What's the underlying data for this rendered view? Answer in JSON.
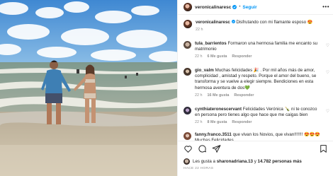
{
  "post": {
    "username": "veronicalinaresc",
    "verified_icon": "verified-badge-icon",
    "dot": "•",
    "follow_label": "Seguir",
    "more_icon": "•••",
    "caption": "Disfrutando con mi flamante esposo 😍",
    "caption_time": "22 h"
  },
  "comments": [
    {
      "username": "tula_barrientos",
      "text": "Formaron una hermosa familia me encanto su matrimonio",
      "time": "22 h",
      "likes": "6 Me gusta",
      "reply": "Responder"
    },
    {
      "username": "gio_valm",
      "text": "Muchas felicidades 🎉 . Por mil años más de amor, complicidad , amistad y respeto. Porque el amor del bueno, se transforma y se vuelve a elegir siempre. Bendiciones en esta hermosa aventura de dos💚",
      "time": "22 h",
      "likes": "16 Me gusta",
      "reply": "Responder"
    },
    {
      "username": "cynthiateronescervant",
      "text": "Felicidades Verónica 🍾 ni te conozco en persona pero tienes algo que hace que me caigas bien",
      "time": "22 h",
      "likes": "8 Me gusta",
      "reply": "Responder"
    },
    {
      "username": "fanny.franco.3511",
      "text": "que vivan los Novios, que vivan!!!!!!! 😍😍😍 Muchas Felicidades",
      "time": "",
      "likes": "",
      "reply": ""
    }
  ],
  "actions": {
    "liked_by_prefix": "Les gusta a",
    "liked_by_user": "sharonadriana.13",
    "liked_by_connector": "y",
    "liked_by_count": "14.782 personas más",
    "date": "HACE 22 HORAS"
  },
  "colors": {
    "accent": "#0095f6",
    "heart_like": "#262626"
  }
}
